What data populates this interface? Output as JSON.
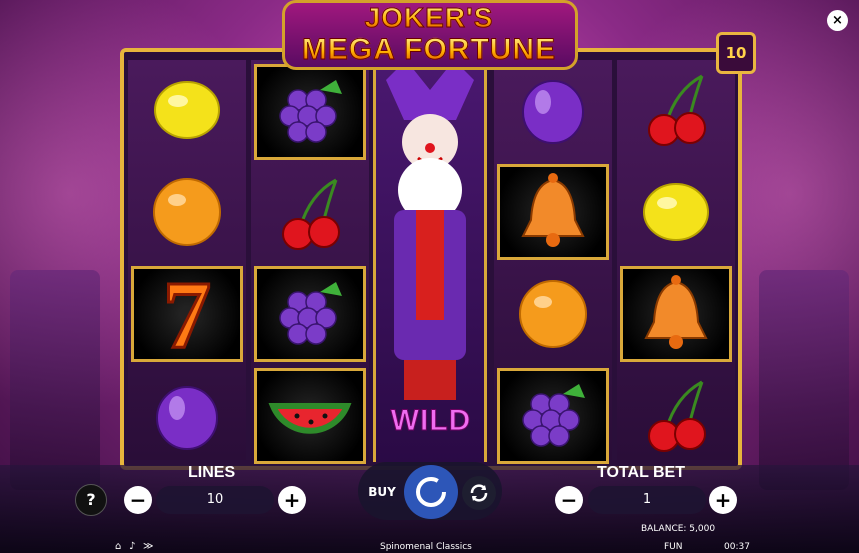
{
  "title": {
    "line1": "JOKER'S",
    "line2": "MEGA FORTUNE"
  },
  "close_label": "×",
  "lines_badge": "10",
  "reels": [
    [
      "lemon-icon",
      "orange-icon",
      "seven-icon",
      "plum-icon"
    ],
    [
      "grapes-icon",
      "cherry-icon",
      "grapes-icon",
      "watermelon-icon"
    ],
    [
      "joker-icon"
    ],
    [
      "plum-icon",
      "bell-icon",
      "orange-icon",
      "grapes-icon"
    ],
    [
      "cherry-icon",
      "lemon-icon",
      "bell-icon",
      "cherry-icon"
    ]
  ],
  "wild_label": "WILD",
  "controls": {
    "help": "?",
    "lines_label": "LINES",
    "lines_value": "10",
    "minus": "−",
    "plus": "+",
    "buy": "BUY",
    "total_bet_label": "TOTAL BET",
    "total_bet_value": "1"
  },
  "footer": {
    "balance": "BALANCE: 5,000",
    "provider": "Spinomenal Classics",
    "mode": "FUN",
    "time": "00:37"
  }
}
